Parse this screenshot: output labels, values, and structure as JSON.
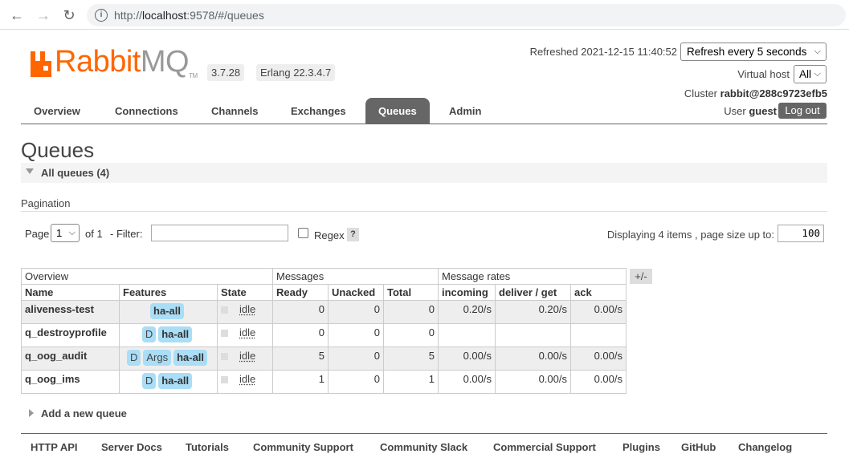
{
  "browser": {
    "url_prefix": "http://",
    "url_host": "localhost",
    "url_rest": ":9578/#/queues"
  },
  "header": {
    "logo_rabbit": "Rabbit",
    "logo_mq": "MQ",
    "logo_tm": "TM",
    "version": "3.7.28",
    "erlang": "Erlang 22.3.4.7",
    "refreshed": "Refreshed 2021-12-15 11:40:52",
    "refresh_option": "Refresh every 5 seconds",
    "vhost_label": "Virtual host",
    "vhost_value": "All",
    "cluster_label": "Cluster",
    "cluster_name": "rabbit@288c9723efb5",
    "user_label": "User",
    "user_name": "guest",
    "logout": "Log out"
  },
  "tabs": [
    {
      "label": "Overview"
    },
    {
      "label": "Connections"
    },
    {
      "label": "Channels"
    },
    {
      "label": "Exchanges"
    },
    {
      "label": "Queues"
    },
    {
      "label": "Admin"
    }
  ],
  "page": {
    "title": "Queues",
    "section": "All queues (4)",
    "pagination_label": "Pagination",
    "page_label": "Page",
    "page_value": "1",
    "of_label": "of 1",
    "filter_label": "- Filter:",
    "filter_value": "",
    "regex_label": "Regex",
    "help": "?",
    "displaying": "Displaying 4 items , page size up to:",
    "page_size": "100",
    "plusminus": "+/-",
    "add_queue": "Add a new queue"
  },
  "table": {
    "groups": [
      "Overview",
      "Messages",
      "Message rates"
    ],
    "columns": [
      "Name",
      "Features",
      "State",
      "Ready",
      "Unacked",
      "Total",
      "incoming",
      "deliver / get",
      "ack"
    ],
    "rows": [
      {
        "name": "aliveness-test",
        "features": [
          "ha-all"
        ],
        "state": "idle",
        "ready": "0",
        "unacked": "0",
        "total": "0",
        "incoming": "0.20/s",
        "deliver": "0.20/s",
        "ack": "0.00/s"
      },
      {
        "name": "q_destroyprofile",
        "features": [
          "D",
          "ha-all"
        ],
        "state": "idle",
        "ready": "0",
        "unacked": "0",
        "total": "0",
        "incoming": "",
        "deliver": "",
        "ack": ""
      },
      {
        "name": "q_oog_audit",
        "features": [
          "D",
          "Args",
          "ha-all"
        ],
        "state": "idle",
        "ready": "5",
        "unacked": "0",
        "total": "5",
        "incoming": "0.00/s",
        "deliver": "0.00/s",
        "ack": "0.00/s"
      },
      {
        "name": "q_oog_ims",
        "features": [
          "D",
          "ha-all"
        ],
        "state": "idle",
        "ready": "1",
        "unacked": "0",
        "total": "1",
        "incoming": "0.00/s",
        "deliver": "0.00/s",
        "ack": "0.00/s"
      }
    ]
  },
  "footer": [
    "HTTP API",
    "Server Docs",
    "Tutorials",
    "Community Support",
    "Community Slack",
    "Commercial Support",
    "Plugins",
    "GitHub",
    "Changelog"
  ],
  "colors": {
    "brand_orange": "#ff6600",
    "tab_active": "#666666",
    "feature_pill": "#aaddf6"
  }
}
